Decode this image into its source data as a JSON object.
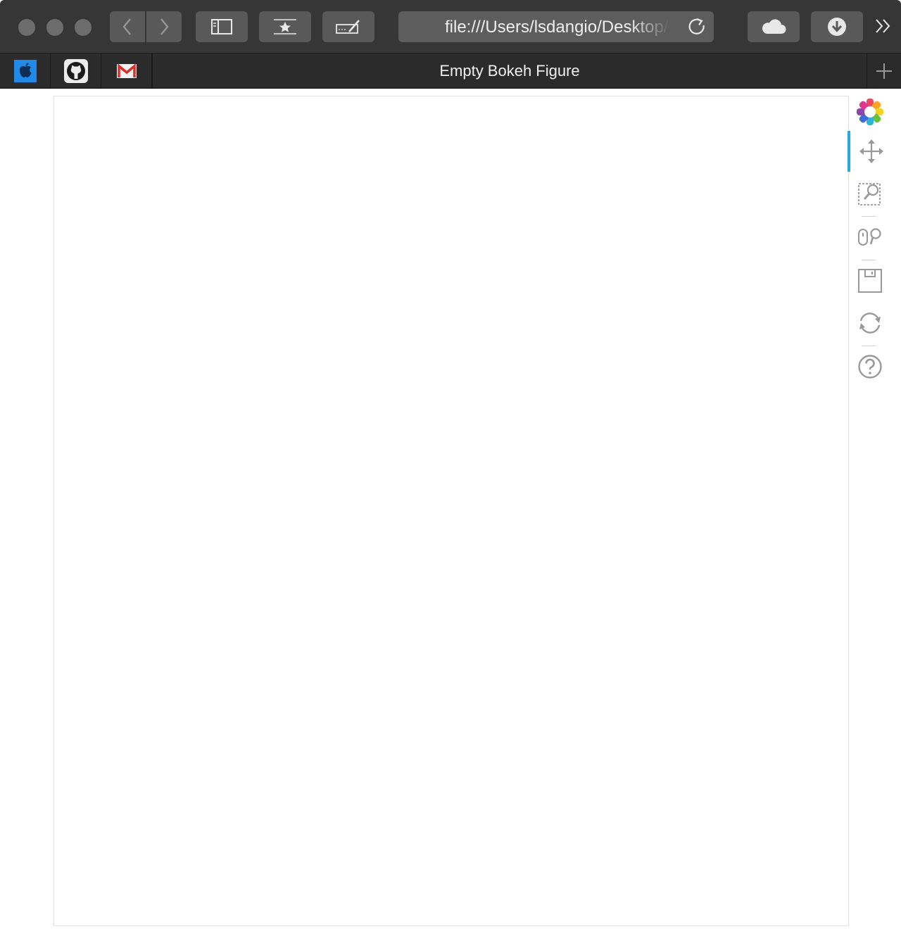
{
  "window": {
    "controls": [
      "close",
      "minimize",
      "zoom"
    ]
  },
  "toolbar": {
    "buttons": [
      "back-icon",
      "forward-icon",
      "sidebar-icon",
      "bookmarks-icon",
      "annotate-icon",
      "icloud-icon",
      "download-icon",
      "overflow-icon"
    ],
    "url": "file:///Users/lsdangio/Desktop/"
  },
  "tabs": {
    "pinned": [
      "apple-icon",
      "github-icon",
      "gmail-icon"
    ],
    "active_title": "Empty Bokeh Figure",
    "new_tab_icon": "plus-icon"
  },
  "figure": {
    "tools": [
      "bokeh-logo-icon",
      "pan-icon",
      "box-zoom-icon",
      "wheel-zoom-icon",
      "save-icon",
      "reset-icon",
      "help-icon"
    ],
    "active_tool": "pan-icon",
    "accent_color": "#26aae1"
  }
}
